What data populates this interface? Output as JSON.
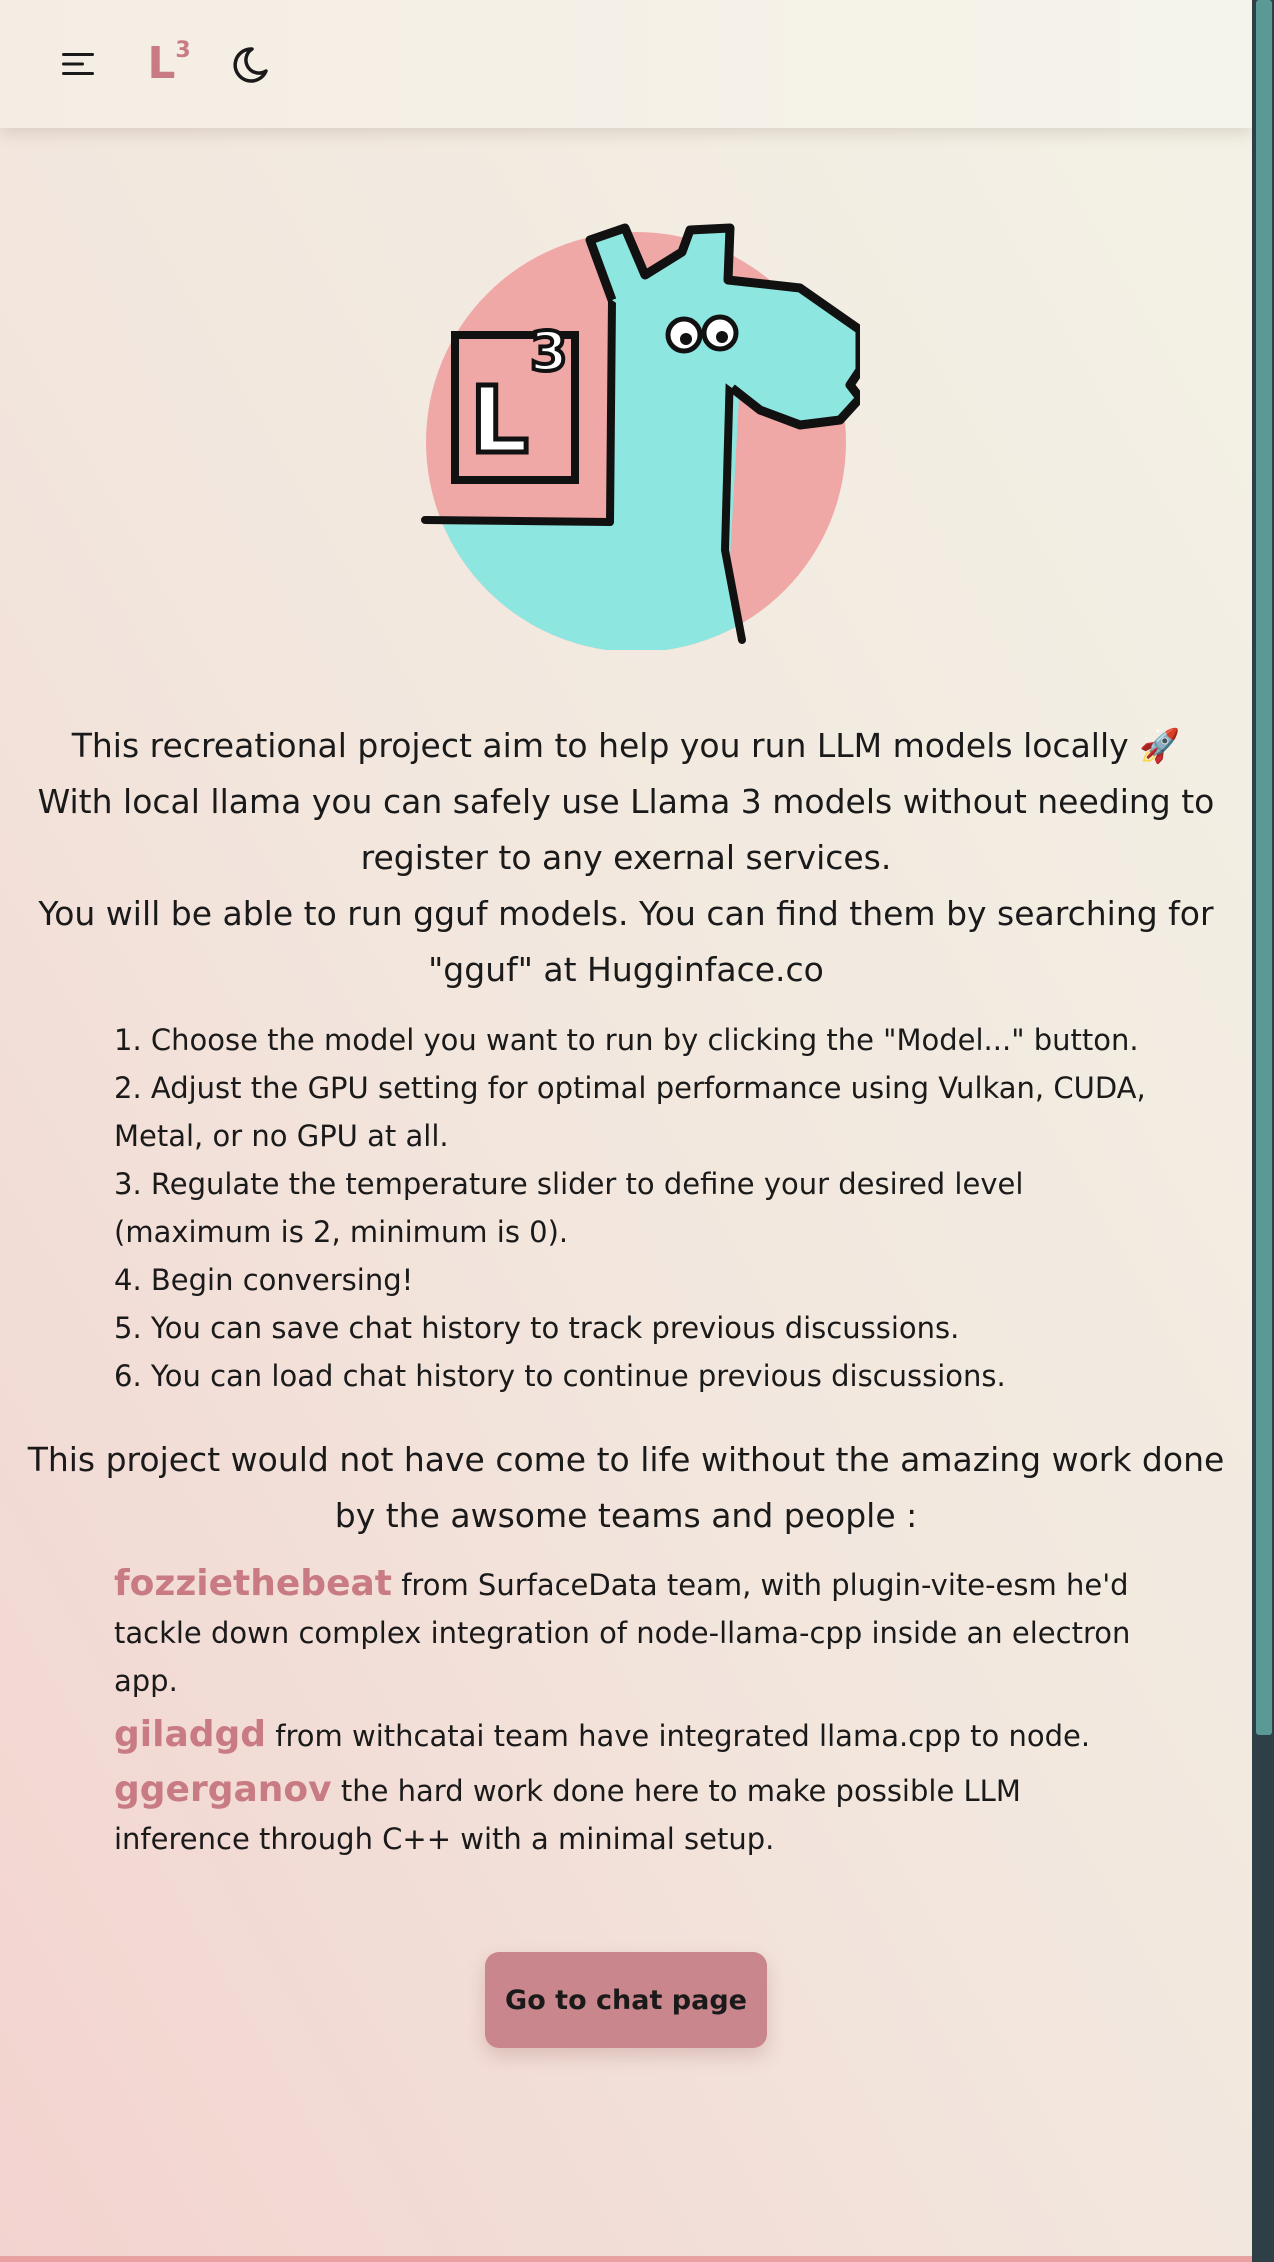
{
  "header": {
    "menu_icon": "menu-icon",
    "logo": {
      "letter": "L",
      "superscript": "3"
    },
    "theme_icon": "moon-icon"
  },
  "hero": {
    "image": "llama-mascot-logo",
    "logo_letter": "L",
    "logo_superscript": "3"
  },
  "intro": {
    "line1": "This recreational project aim to help you run LLM models locally 🚀",
    "line2": "With local llama you can safely use Llama 3 models without needing to register to any exernal services.",
    "line3": "You will be able to run gguf models. You can find them by searching for \"gguf\" at Hugginface.co"
  },
  "steps": [
    "1. Choose the model you want to run by clicking the \"Model...\" button.",
    "2. Adjust the GPU setting for optimal performance using Vulkan, CUDA, Metal, or no GPU at all.",
    "3. Regulate the temperature slider to define your desired level (maximum is 2, minimum is 0).",
    "4. Begin conversing!",
    "5. You can save chat history to track previous discussions.",
    "6. You can load chat history to continue previous discussions."
  ],
  "thanks": "This project would not have come to life without the amazing work done by the awsome teams and people :",
  "credits": [
    {
      "name": "fozziethebeat",
      "text": " from SurfaceData team, with plugin-vite-esm he'd tackle down complex integration of node-llama-cpp inside an electron app."
    },
    {
      "name": "giladgd",
      "text": " from withcatai team have integrated llama.cpp to node."
    },
    {
      "name": "ggerganov",
      "text": " the hard work done here to make possible LLM inference through C++ with a minimal setup."
    }
  ],
  "cta": {
    "label": "Go to chat page"
  },
  "colors": {
    "accent": "#c97b83",
    "button": "#c9868c",
    "scrollbar_thumb": "#5b9a94",
    "scrollbar_track": "#2f3f47"
  }
}
